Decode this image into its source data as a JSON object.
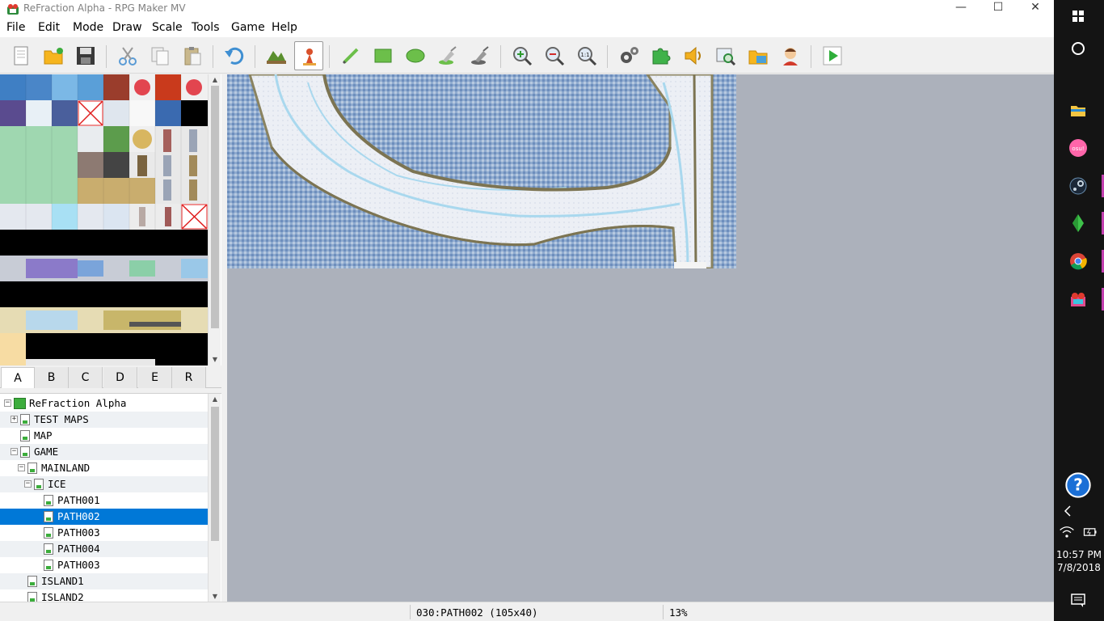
{
  "window": {
    "title": "ReFraction Alpha - RPG Maker MV",
    "minimize": "—",
    "maximize": "☐",
    "close": "✕"
  },
  "menu": [
    "File",
    "Edit",
    "Mode",
    "Draw",
    "Scale",
    "Tools",
    "Game",
    "Help"
  ],
  "toolbar": {
    "buttons": [
      "new-project",
      "open-project",
      "save-project",
      "cut",
      "copy",
      "paste",
      "undo",
      "map-mode",
      "event-mode",
      "pencil",
      "rectangle",
      "ellipse",
      "flood-fill",
      "shadow-pen",
      "zoom-in",
      "zoom-out",
      "actual-size",
      "database",
      "plugin-manager",
      "sound-test",
      "event-searcher",
      "resource-manager",
      "character-generator",
      "playtest"
    ],
    "active": "event-mode"
  },
  "tileset_tabs": [
    "A",
    "B",
    "C",
    "D",
    "E",
    "R"
  ],
  "selected_tab": "A",
  "map_tree": [
    {
      "label": "ReFraction Alpha",
      "depth": 0,
      "expander": "−",
      "type": "project"
    },
    {
      "label": "TEST MAPS",
      "depth": 1,
      "expander": "+",
      "type": "map"
    },
    {
      "label": "MAP",
      "depth": 1,
      "expander": "",
      "type": "map"
    },
    {
      "label": "GAME",
      "depth": 1,
      "expander": "−",
      "type": "map"
    },
    {
      "label": "MAINLAND",
      "depth": 2,
      "expander": "−",
      "type": "map"
    },
    {
      "label": "ICE",
      "depth": 3,
      "expander": "−",
      "type": "map"
    },
    {
      "label": "PATH001",
      "depth": 4,
      "expander": "",
      "type": "map"
    },
    {
      "label": "PATH002",
      "depth": 4,
      "expander": "",
      "type": "map",
      "selected": true
    },
    {
      "label": "PATH003",
      "depth": 4,
      "expander": "",
      "type": "map"
    },
    {
      "label": "PATH004",
      "depth": 4,
      "expander": "",
      "type": "map"
    },
    {
      "label": "PATH003",
      "depth": 4,
      "expander": "",
      "type": "map"
    },
    {
      "label": "ISLAND1",
      "depth": 2,
      "expander": "",
      "type": "map"
    },
    {
      "label": "ISLAND2",
      "depth": 2,
      "expander": "",
      "type": "map"
    }
  ],
  "status": {
    "map": "030:PATH002 (105x40)",
    "zoom": "13%"
  },
  "taskbar": {
    "time": "10:57 PM",
    "date": "7/8/2018",
    "apps": [
      "file-explorer",
      "osu",
      "steam",
      "sims",
      "chrome",
      "rpg-maker"
    ],
    "osu_label": "osu!"
  },
  "colors": {
    "selection": "#0078d7",
    "canvas_bg": "#acb1bb",
    "water": "#7e9ec4",
    "snow": "#e8ecf2",
    "cliff": "#8a8360",
    "ice_river": "#9fd4ea"
  }
}
